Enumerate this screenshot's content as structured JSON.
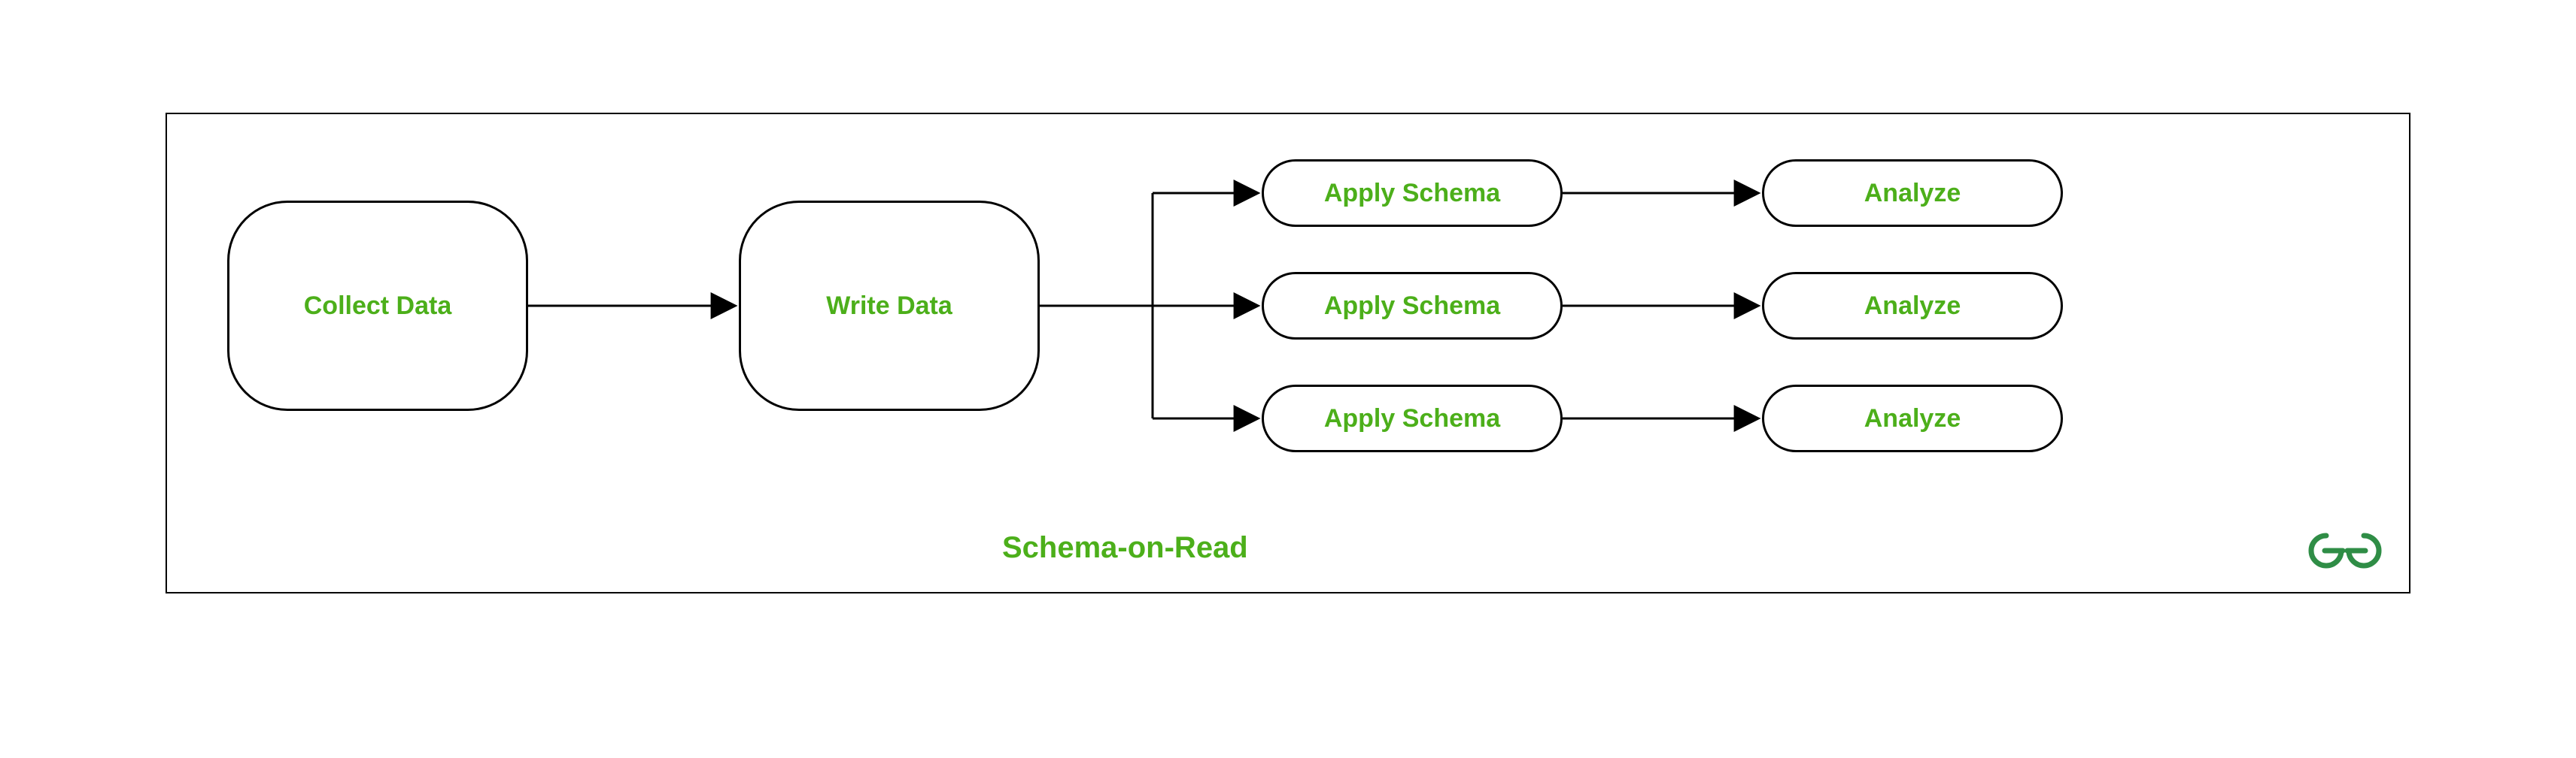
{
  "diagram": {
    "title": "Schema-on-Read",
    "collect": "Collect Data",
    "write": "Write Data",
    "schema1": "Apply Schema",
    "schema2": "Apply Schema",
    "schema3": "Apply Schema",
    "analyze1": "Analyze",
    "analyze2": "Analyze",
    "analyze3": "Analyze"
  },
  "colors": {
    "accent": "#4CAF1A",
    "logo": "#2F8D46",
    "border": "#000000"
  }
}
